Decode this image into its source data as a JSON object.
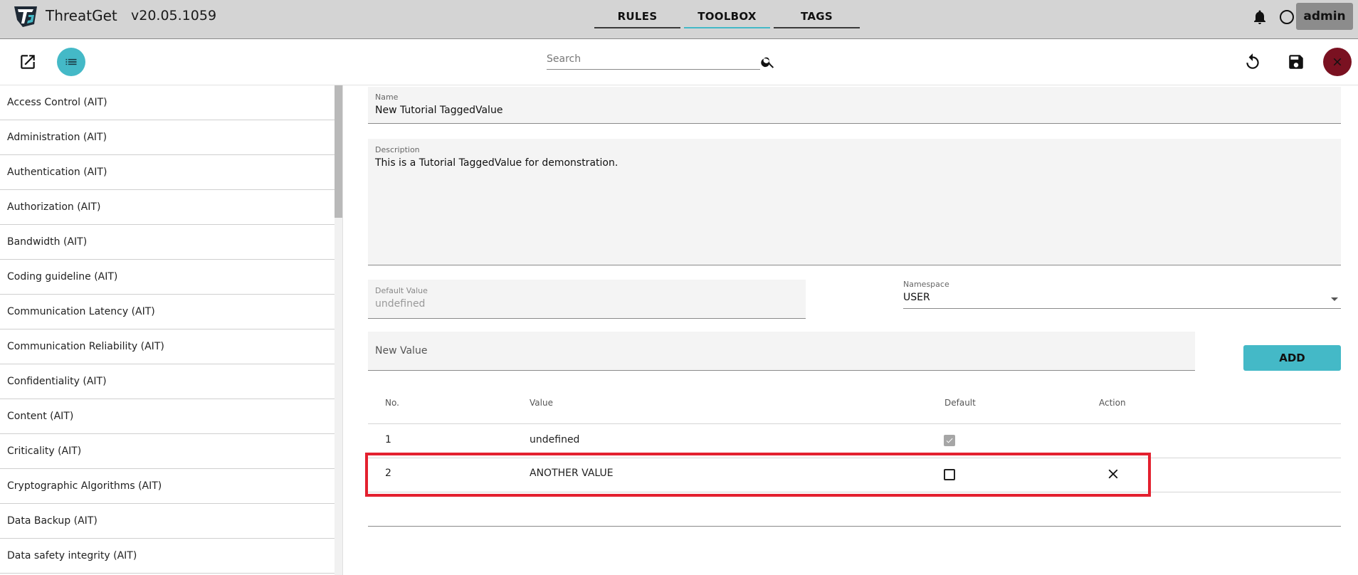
{
  "app": {
    "name": "ThreatGet",
    "version": "v20.05.1059"
  },
  "nav": {
    "tabs": [
      {
        "label": "RULES"
      },
      {
        "label": "TOOLBOX"
      },
      {
        "label": "TAGS"
      }
    ],
    "active": "TOOLBOX"
  },
  "user": {
    "label": "admin"
  },
  "toolbar": {
    "search_placeholder": "Search"
  },
  "sidebar": {
    "items": [
      {
        "label": "Access Control (AIT)"
      },
      {
        "label": "Administration (AIT)"
      },
      {
        "label": "Authentication (AIT)"
      },
      {
        "label": "Authorization (AIT)"
      },
      {
        "label": "Bandwidth (AIT)"
      },
      {
        "label": "Coding guideline (AIT)"
      },
      {
        "label": "Communication Latency (AIT)"
      },
      {
        "label": "Communication Reliability (AIT)"
      },
      {
        "label": "Confidentiality (AIT)"
      },
      {
        "label": "Content (AIT)"
      },
      {
        "label": "Criticality (AIT)"
      },
      {
        "label": "Cryptographic Algorithms (AIT)"
      },
      {
        "label": "Data Backup (AIT)"
      },
      {
        "label": "Data safety integrity (AIT)"
      }
    ]
  },
  "form": {
    "name": {
      "label": "Name",
      "value": "New Tutorial TaggedValue"
    },
    "description": {
      "label": "Description",
      "value": "This is  a Tutorial TaggedValue for demonstration."
    },
    "default_value": {
      "label": "Default Value",
      "value": "undefined"
    },
    "namespace": {
      "label": "Namespace",
      "value": "USER"
    },
    "new_value": {
      "placeholder": "New Value"
    },
    "add_button": "ADD"
  },
  "table": {
    "headers": {
      "no": "No.",
      "value": "Value",
      "default": "Default",
      "action": "Action"
    },
    "rows": [
      {
        "no": "1",
        "value": "undefined",
        "default": true
      },
      {
        "no": "2",
        "value": "ANOTHER VALUE",
        "default": false
      }
    ]
  },
  "colors": {
    "accent": "#44b9c7",
    "close": "#7a1121",
    "highlight": "#e3202f",
    "appbar": "#d4d4d4"
  },
  "icons": {
    "logo": "threatget-logo",
    "open": "open-in-new-icon",
    "list": "list-icon",
    "search": "search-icon",
    "bell": "bell-icon",
    "status": "circle-icon",
    "undo": "undo-icon",
    "save": "save-icon",
    "close": "close-icon",
    "remove": "remove-row-icon"
  }
}
